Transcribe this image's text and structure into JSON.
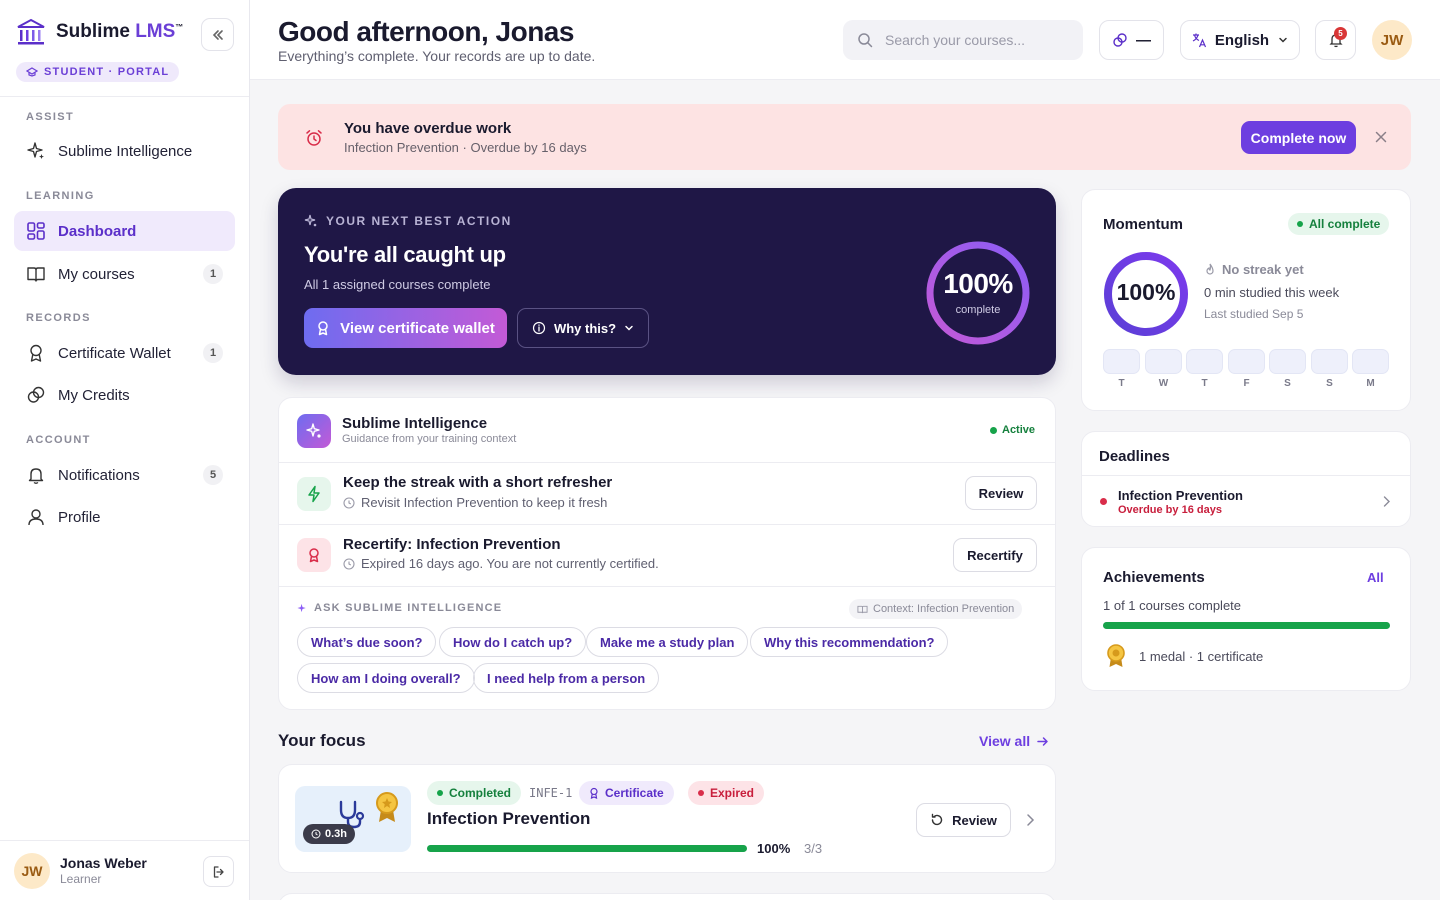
{
  "brand": {
    "name": "Sublime",
    "suffix": "LMS",
    "tm": "™",
    "portal": "STUDENT · PORTAL"
  },
  "sidebar": {
    "sections": {
      "assist": "ASSIST",
      "learning": "LEARNING",
      "records": "RECORDS",
      "account": "ACCOUNT"
    },
    "items": [
      {
        "label": "Sublime Intelligence",
        "icon": "sparkles-icon"
      },
      {
        "label": "Dashboard",
        "icon": "grid-icon",
        "active": true
      },
      {
        "label": "My courses",
        "icon": "book-icon",
        "count": "1"
      },
      {
        "label": "Certificate Wallet",
        "icon": "award-icon",
        "count": "1"
      },
      {
        "label": "My Credits",
        "icon": "coins-icon"
      },
      {
        "label": "Notifications",
        "icon": "bell-icon",
        "count": "5"
      },
      {
        "label": "Profile",
        "icon": "user-icon"
      }
    ],
    "user": {
      "initials": "JW",
      "name": "Jonas Weber",
      "role": "Learner"
    }
  },
  "header": {
    "greeting": "Good afternoon, Jonas",
    "subtitle": "Everything’s complete. Your records are up to date.",
    "search_placeholder": "Search your courses...",
    "credits_value": "—",
    "language": "English",
    "notif_count": "5",
    "avatar_initials": "JW"
  },
  "overdue": {
    "title": "You have overdue work",
    "subtitle": "Infection Prevention · Overdue by 16 days",
    "action": "Complete now"
  },
  "hero": {
    "eyebrow": "YOUR NEXT BEST ACTION",
    "title": "You're all caught up",
    "subtitle": "All 1 assigned courses complete",
    "primary": "View certificate wallet",
    "secondary": "Why this?",
    "progress_label": "100%",
    "progress_caption": "complete",
    "progress": 1.0
  },
  "intelligence": {
    "title": "Sublime Intelligence",
    "subtitle": "Guidance from your training context",
    "status": "Active",
    "recs": [
      {
        "title": "Keep the streak with a short refresher",
        "sub": "Revisit Infection Prevention to keep it fresh",
        "action": "Review"
      },
      {
        "title": "Recertify: Infection Prevention",
        "sub": "Expired 16 days ago. You are not currently certified.",
        "action": "Recertify"
      }
    ],
    "ask_label": "ASK SUBLIME INTELLIGENCE",
    "context": "Context: Infection Prevention",
    "chips": [
      "What’s due soon?",
      "How do I catch up?",
      "Make me a study plan",
      "Why this recommendation?",
      "How am I doing overall?",
      "I need help from a person"
    ]
  },
  "focus": {
    "title": "Your focus",
    "view_all": "View all",
    "course": {
      "duration": "0.3h",
      "tags": {
        "completed": "Completed",
        "code": "INFE-1",
        "certificate": "Certificate",
        "expired": "Expired"
      },
      "name": "Infection Prevention",
      "percent": "100%",
      "progress": 1.0,
      "modules": "3/3",
      "action": "Review"
    }
  },
  "momentum": {
    "title": "Momentum",
    "status": "All complete",
    "percent": "100%",
    "progress": 1.0,
    "streak": "No streak yet",
    "minutes": "0 min studied this week",
    "last": "Last studied Sep 5",
    "days": [
      "T",
      "W",
      "T",
      "F",
      "S",
      "S",
      "M"
    ]
  },
  "deadlines": {
    "title": "Deadlines",
    "items": [
      {
        "name": "Infection Prevention",
        "status": "Overdue by 16 days"
      }
    ]
  },
  "achievements": {
    "title": "Achievements",
    "link": "All",
    "summary": "1 of 1 courses complete",
    "progress": 1.0,
    "medals": "1 medal · 1 certificate"
  },
  "colors": {
    "accent": "#6d3ee0",
    "hero_bg": "#1f1746",
    "success": "#16a34a",
    "danger": "#d92d4a"
  }
}
